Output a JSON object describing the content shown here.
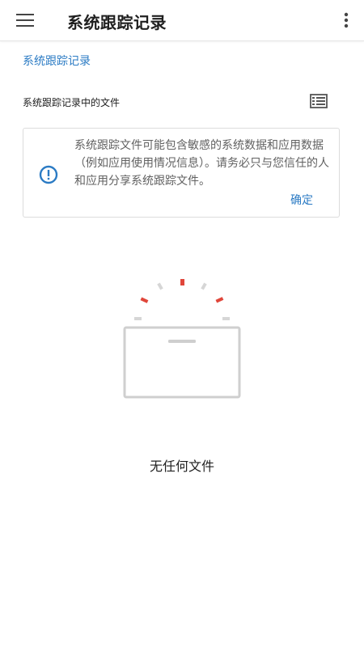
{
  "appbar": {
    "title": "系统跟踪记录",
    "menu_icon": "hamburger-menu-icon",
    "overflow_icon": "more-vert-icon"
  },
  "breadcrumb": {
    "label": "系统跟踪记录"
  },
  "section": {
    "title": "系统跟踪记录中的文件",
    "list_icon": "view-list-icon"
  },
  "warning_card": {
    "icon": "error-outline-icon",
    "message": "系统跟踪文件可能包含敏感的系统数据和应用数据（例如应用使用情况信息）。请务必只与您信任的人和应用分享系统跟踪文件。",
    "confirm_label": "确定"
  },
  "empty_state": {
    "illustration": "empty-box-icon",
    "label": "无任何文件"
  },
  "colors": {
    "accent": "#2b7bc4",
    "sparkle_red": "#e0463a",
    "sparkle_gray": "#d6d6d6",
    "box_gray": "#cfcfcf"
  }
}
